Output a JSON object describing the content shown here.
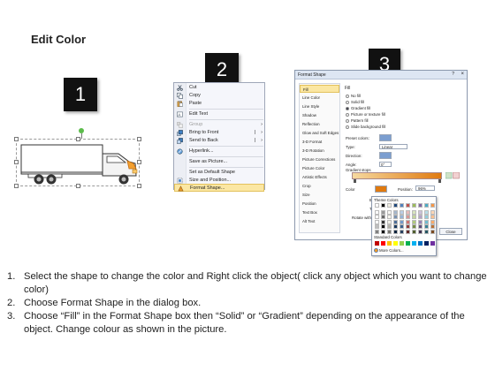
{
  "title": "Edit Color",
  "steps": {
    "one": "1",
    "two": "2",
    "three": "3"
  },
  "context_menu": {
    "items": [
      {
        "label": "Cut",
        "icon": "scissors-icon"
      },
      {
        "label": "Copy",
        "icon": "copy-icon"
      },
      {
        "label": "Paste",
        "icon": "paste-icon"
      },
      {
        "label": "Edit Text",
        "icon": "edit-text-icon"
      },
      {
        "label": "Group",
        "icon": "group-icon"
      },
      {
        "label": "Bring to Front",
        "icon": "bring-front-icon"
      },
      {
        "label": "Send to Back",
        "icon": "send-back-icon"
      },
      {
        "label": "Hyperlink...",
        "icon": "hyperlink-icon"
      },
      {
        "label": "Save as Picture...",
        "icon": ""
      },
      {
        "label": "Set as Default Shape",
        "icon": ""
      },
      {
        "label": "Size and Position...",
        "icon": "size-position-icon"
      },
      {
        "label": "Format Shape...",
        "icon": "format-shape-icon"
      }
    ]
  },
  "format_shape": {
    "title": "Format Shape",
    "categories": [
      "Fill",
      "Line Color",
      "Line Style",
      "Shadow",
      "Reflection",
      "Glow and Soft Edges",
      "3-D Format",
      "3-D Rotation",
      "Picture Corrections",
      "Picture Color",
      "Artistic Effects",
      "Crop",
      "Size",
      "Position",
      "Text Box",
      "Alt Text"
    ],
    "fill_heading": "Fill",
    "fill_options": [
      "No fill",
      "Solid fill",
      "Gradient fill",
      "Picture or texture fill",
      "Pattern fill",
      "Slide background fill"
    ],
    "selected_fill": "Gradient fill",
    "preset_colors_label": "Preset colors:",
    "type_label": "Type:",
    "type_value": "Linear",
    "direction_label": "Direction:",
    "angle_label": "Angle:",
    "angle_value": "0°",
    "gradient_stops_label": "Gradient stops",
    "color_label": "Color",
    "position_label": "Position:",
    "position_value": "96%",
    "brightness_label": "Brightness:",
    "transparency_label": "Transparency:",
    "rotate_label": "Rotate with shape",
    "theme_colors_label": "Theme Colors",
    "standard_colors_label": "Standard Colors",
    "more_colors_label": "More Colors...",
    "close_label": "Close",
    "gradient_start_color": "#f6d9a0",
    "gradient_end_color": "#e07a10"
  },
  "instructions": [
    {
      "num": "1.",
      "text": "Select the shape to change the color and Right click the object( click any object which you want to change color)"
    },
    {
      "num": "2.",
      "text": "Choose Format Shape in the dialog box."
    },
    {
      "num": "3.",
      "text": "Choose “Fill” in the Format Shape box then “Solid” or “Gradient” depending on the appearance of the object. Change colour as shown in the picture."
    }
  ]
}
